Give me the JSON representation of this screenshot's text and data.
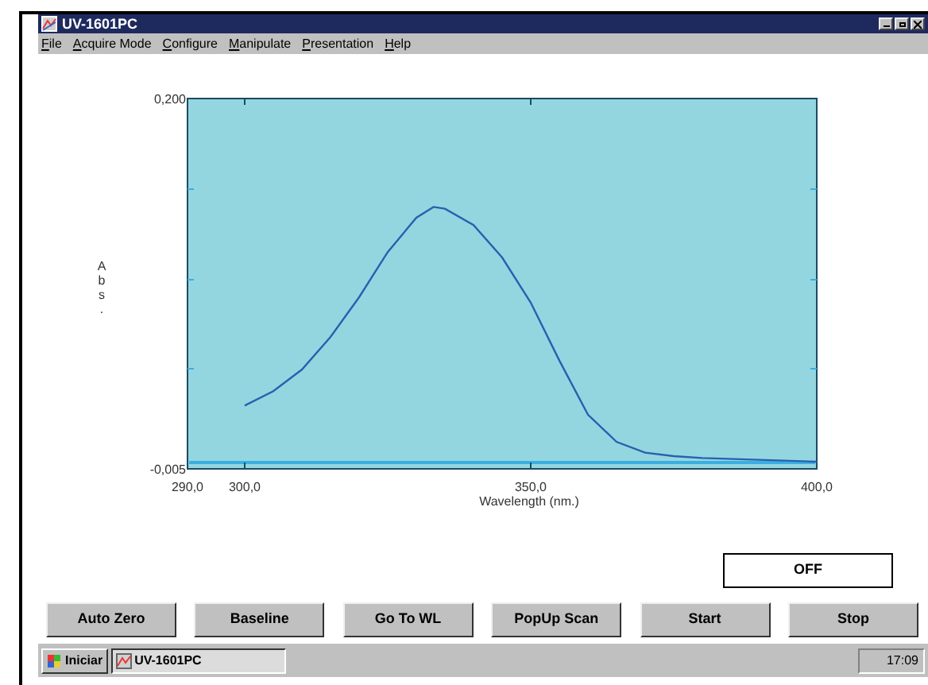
{
  "window": {
    "title": "UV-1601PC"
  },
  "menu": [
    {
      "label": "File"
    },
    {
      "label": "Acquire Mode"
    },
    {
      "label": "Configure"
    },
    {
      "label": "Manipulate"
    },
    {
      "label": "Presentation"
    },
    {
      "label": "Help"
    }
  ],
  "chart_data": {
    "type": "line",
    "xlabel": "Wavelength (nm.)",
    "ylabel": "Abs.",
    "x": [
      300,
      305,
      310,
      315,
      320,
      325,
      330,
      333,
      335,
      340,
      345,
      350,
      355,
      360,
      365,
      370,
      375,
      380,
      390,
      400
    ],
    "values": [
      0.03,
      0.038,
      0.05,
      0.068,
      0.09,
      0.115,
      0.134,
      0.14,
      0.139,
      0.13,
      0.112,
      0.087,
      0.055,
      0.025,
      0.01,
      0.004,
      0.002,
      0.001,
      0.0,
      -0.001
    ],
    "xlim": [
      290,
      400
    ],
    "ylim": [
      -0.005,
      0.2
    ],
    "xticks": [
      {
        "value": 290,
        "label": "290,0"
      },
      {
        "value": 300,
        "label": "300,0"
      },
      {
        "value": 350,
        "label": "350,0"
      },
      {
        "value": 400,
        "label": "400,0"
      }
    ],
    "yticks": [
      {
        "value": 0.2,
        "label": "0,200"
      },
      {
        "value": -0.005,
        "label": "-0,005"
      }
    ],
    "ref_lines": [
      {
        "axis": "y",
        "value": -0.0015
      }
    ]
  },
  "status_display": "OFF",
  "buttons": [
    "Auto Zero",
    "Baseline",
    "Go To WL",
    "PopUp Scan",
    "Start",
    "Stop"
  ],
  "taskbar": {
    "start_label": "Iniciar",
    "tasks": [
      {
        "label": "UV-1601PC",
        "selected": true
      }
    ],
    "clock": "17:09"
  }
}
